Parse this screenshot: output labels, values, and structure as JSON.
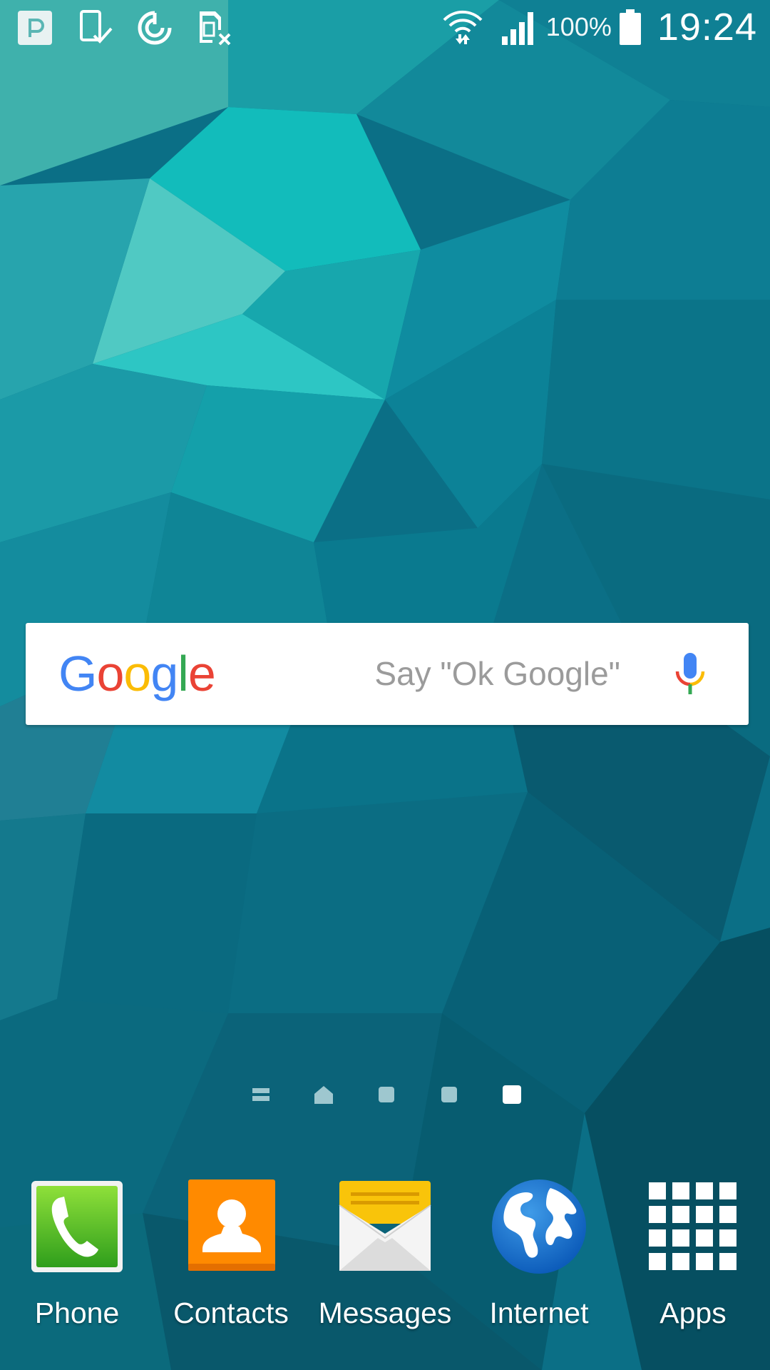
{
  "status_bar": {
    "left_icons": [
      "pushbullet-icon",
      "screenshot-icon",
      "sync-icon",
      "sim-card-icon"
    ],
    "right_icons": [
      "wifi-icon",
      "signal-icon",
      "battery-icon"
    ],
    "battery_percent": "100%",
    "time": "19:24"
  },
  "search": {
    "logo_text": "Google",
    "hint": "Say \"Ok Google\"",
    "mic_icon": "mic-icon"
  },
  "page_indicators": {
    "pages": [
      "menu",
      "home",
      "page",
      "page",
      "page"
    ],
    "active_index": 4
  },
  "dock": {
    "items": [
      {
        "label": "Phone",
        "icon": "phone-icon"
      },
      {
        "label": "Contacts",
        "icon": "contacts-icon"
      },
      {
        "label": "Messages",
        "icon": "messages-icon"
      },
      {
        "label": "Internet",
        "icon": "globe-icon"
      },
      {
        "label": "Apps",
        "icon": "apps-grid-icon"
      }
    ]
  },
  "colors": {
    "google_blue": "#4285F4",
    "google_red": "#EA4335",
    "google_yellow": "#FBBC05",
    "google_green": "#34A853",
    "hint_gray": "#9b9b9b"
  }
}
